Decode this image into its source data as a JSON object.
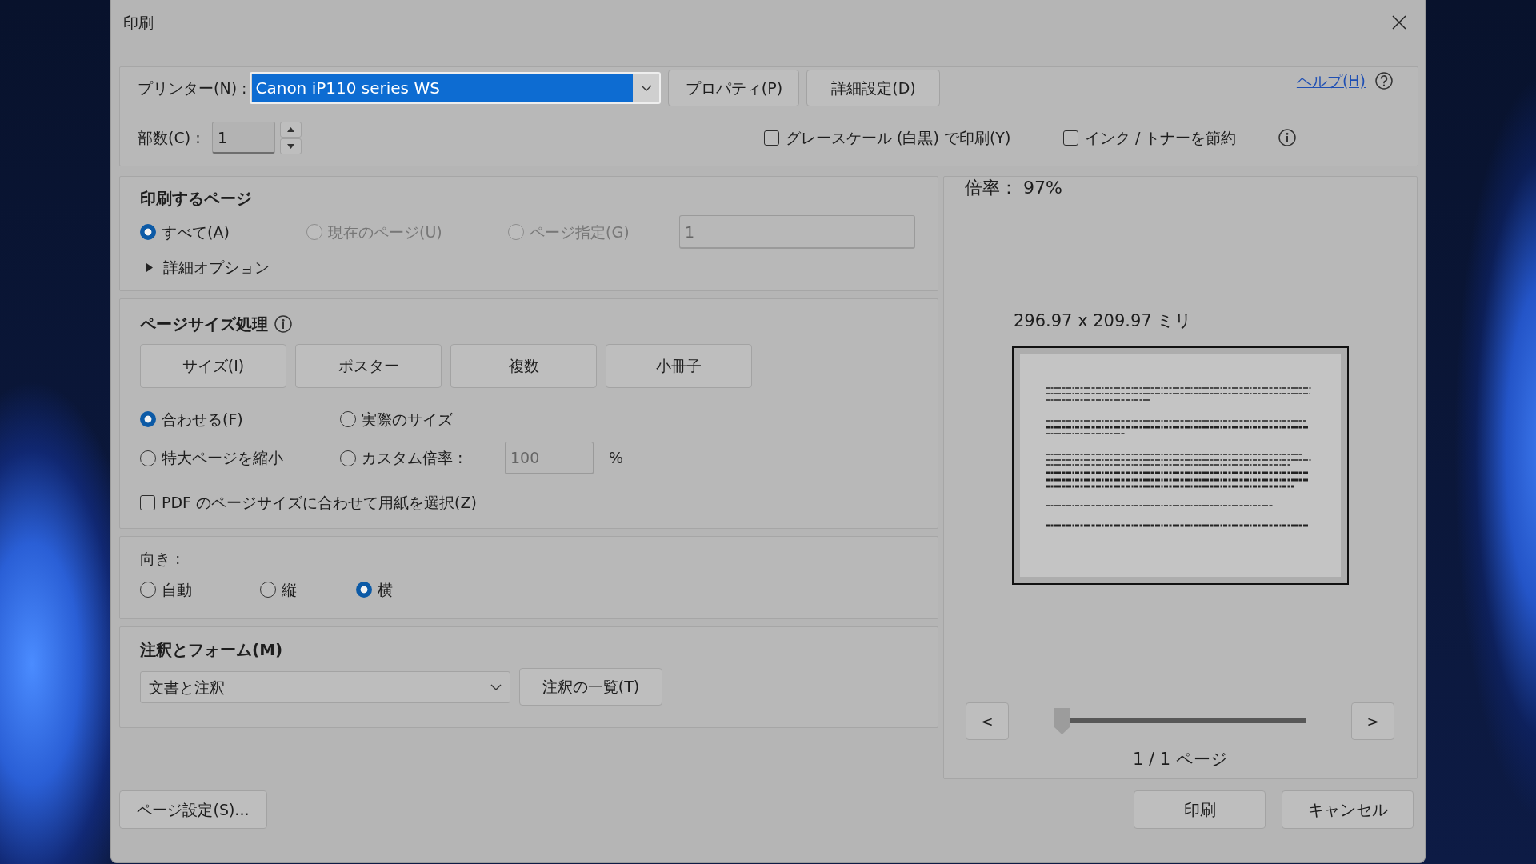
{
  "window": {
    "title": "印刷"
  },
  "printer": {
    "label": "プリンター(N) :",
    "value": "Canon iP110 series WS",
    "highlighted": true
  },
  "printer_buttons": [
    {
      "label": "プロパティ(P)"
    },
    {
      "label": "詳細設定(D)"
    }
  ],
  "help": {
    "label": "ヘルプ(H)"
  },
  "copies": {
    "label": "部数(C) :",
    "value": "1"
  },
  "print_options": [
    {
      "label": "グレースケール (白黒) で印刷(Y)",
      "checked": false
    },
    {
      "label": "インク / トナーを節約",
      "checked": false
    }
  ],
  "pages_to_print": {
    "heading": "印刷するページ",
    "choices": [
      {
        "label": "すべて(A)",
        "selected": true,
        "disabled": false
      },
      {
        "label": "現在のページ(U)",
        "selected": false,
        "disabled": true
      },
      {
        "label": "ページ指定(G)",
        "selected": false,
        "disabled": true
      }
    ],
    "range": {
      "value": "1",
      "disabled": true
    },
    "more_options": {
      "label": "詳細オプション",
      "expanded": false
    }
  },
  "page_sizing": {
    "heading": "ページサイズ処理",
    "modes": [
      {
        "label": "サイズ(I)"
      },
      {
        "label": "ポスター"
      },
      {
        "label": "複数"
      },
      {
        "label": "小冊子"
      }
    ],
    "scaling": [
      {
        "label": "合わせる(F)",
        "selected": true
      },
      {
        "label": "実際のサイズ",
        "selected": false
      },
      {
        "label": "特大ページを縮小",
        "selected": false
      },
      {
        "label": "カスタム倍率 :",
        "selected": false
      }
    ],
    "custom_scale": {
      "value": "100",
      "unit": "%",
      "disabled": true
    },
    "paper_by_pdf_size": {
      "label": "PDF のページサイズに合わせて用紙を選択(Z)",
      "checked": false
    }
  },
  "orientation": {
    "label": "向き :",
    "choices": [
      {
        "label": "自動",
        "selected": false
      },
      {
        "label": "縦",
        "selected": false
      },
      {
        "label": "横",
        "selected": true
      }
    ]
  },
  "comments_and_forms": {
    "heading": "注釈とフォーム(M)",
    "value": "文書と注釈",
    "summary_button": "注釈の一覧(T)"
  },
  "page_setup_button": "ページ設定(S)...",
  "preview": {
    "zoom": "倍率： 97%",
    "paper_size": "296.97 x 209.97 ミリ",
    "prev_button": "<",
    "next_button": ">",
    "page_slider": {
      "level": 0
    },
    "page_count": "1 / 1 ページ"
  },
  "dialog_buttons": [
    {
      "label": "印刷"
    },
    {
      "label": "キャンセル"
    }
  ]
}
